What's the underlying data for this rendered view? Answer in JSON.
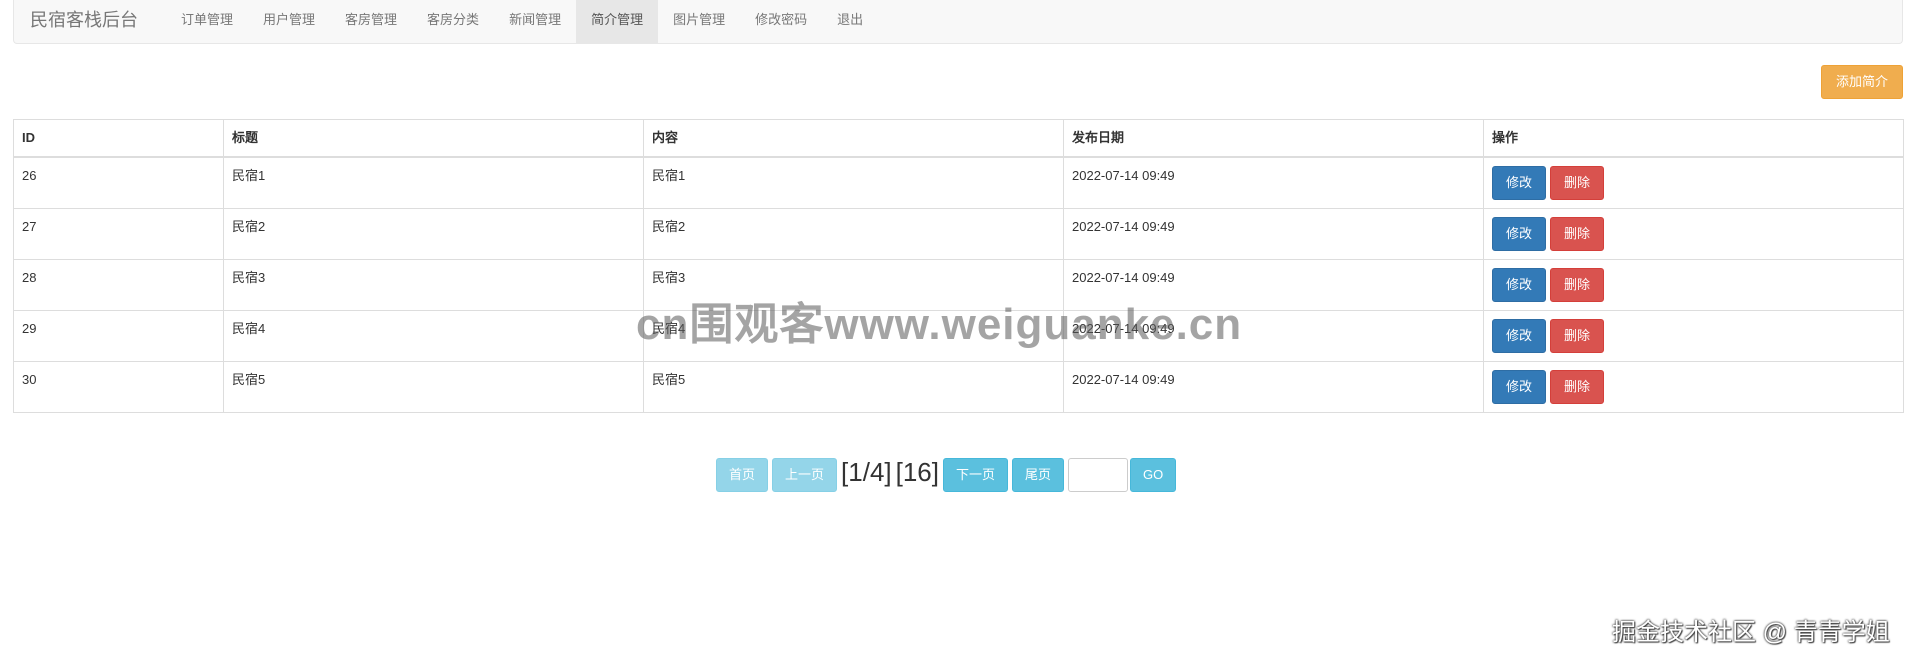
{
  "nav": {
    "brand": "民宿客栈后台",
    "items": [
      {
        "label": "订单管理",
        "active": false
      },
      {
        "label": "用户管理",
        "active": false
      },
      {
        "label": "客房管理",
        "active": false
      },
      {
        "label": "客房分类",
        "active": false
      },
      {
        "label": "新闻管理",
        "active": false
      },
      {
        "label": "简介管理",
        "active": true
      },
      {
        "label": "图片管理",
        "active": false
      },
      {
        "label": "修改密码",
        "active": false
      },
      {
        "label": "退出",
        "active": false
      }
    ]
  },
  "toolbar": {
    "add_label": "添加简介"
  },
  "table": {
    "headers": [
      "ID",
      "标题",
      "内容",
      "发布日期",
      "操作"
    ],
    "rows": [
      {
        "id": "26",
        "title": "民宿1",
        "content": "民宿1",
        "date": "2022-07-14 09:49"
      },
      {
        "id": "27",
        "title": "民宿2",
        "content": "民宿2",
        "date": "2022-07-14 09:49"
      },
      {
        "id": "28",
        "title": "民宿3",
        "content": "民宿3",
        "date": "2022-07-14 09:49"
      },
      {
        "id": "29",
        "title": "民宿4",
        "content": "民宿4",
        "date": "2022-07-14 09:49"
      },
      {
        "id": "30",
        "title": "民宿5",
        "content": "民宿5",
        "date": "2022-07-14 09:49"
      }
    ],
    "edit_label": "修改",
    "delete_label": "删除"
  },
  "pager": {
    "first_label": "首页",
    "prev_label": "上一页",
    "page_info": "[1/4]",
    "total_info": "[16]",
    "next_label": "下一页",
    "last_label": "尾页",
    "go_label": "GO",
    "jump_value": ""
  },
  "watermarks": {
    "center": "cn围观客www.weiguanke.cn",
    "corner": "掘金技术社区 @ 青青学姐"
  },
  "colors": {
    "primary": "#337ab7",
    "danger": "#d9534f",
    "warning": "#f0ad4e",
    "info": "#5bc0de"
  }
}
